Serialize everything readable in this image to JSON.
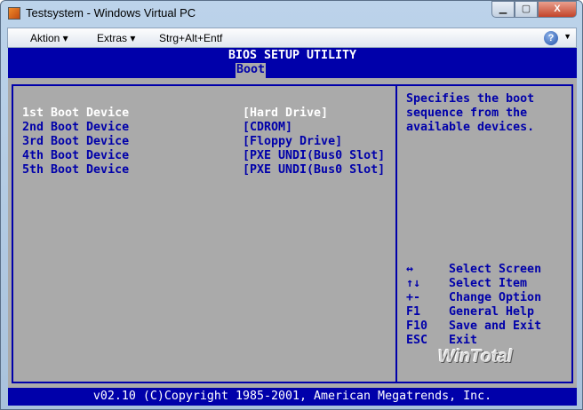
{
  "window": {
    "title": "Testsystem - Windows Virtual PC",
    "min": "▁",
    "max": "▢",
    "close": "X"
  },
  "menu": [
    {
      "label": "Aktion ▾"
    },
    {
      "label": "Extras ▾"
    },
    {
      "label": "Strg+Alt+Entf"
    }
  ],
  "help_icon": "?",
  "bios": {
    "title": "BIOS SETUP UTILITY",
    "tab": "Boot",
    "items": [
      {
        "label": "1st Boot Device",
        "value": "[Hard Drive]",
        "selected": true
      },
      {
        "label": "2nd Boot Device",
        "value": "[CDROM]"
      },
      {
        "label": "3rd Boot Device",
        "value": "[Floppy Drive]"
      },
      {
        "label": "4th Boot Device",
        "value": "[PXE UNDI(Bus0 Slot]"
      },
      {
        "label": "5th Boot Device",
        "value": "[PXE UNDI(Bus0 Slot]"
      }
    ],
    "help_text": [
      "Specifies the boot",
      "sequence from the",
      "available devices."
    ],
    "keys": [
      {
        "key": "↔",
        "desc": "Select Screen"
      },
      {
        "key": "↑↓",
        "desc": "Select Item"
      },
      {
        "key": "+-",
        "desc": "Change Option"
      },
      {
        "key": "F1",
        "desc": "General Help"
      },
      {
        "key": "F10",
        "desc": "Save and Exit"
      },
      {
        "key": "ESC",
        "desc": "Exit"
      }
    ],
    "watermark": "WinTotal",
    "footer": "v02.10 (C)Copyright 1985-2001, American Megatrends, Inc."
  }
}
